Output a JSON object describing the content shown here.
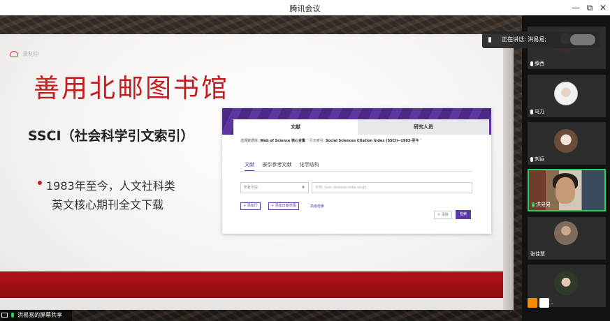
{
  "window": {
    "title": "腾讯会议",
    "minimize": "—",
    "restore": "⧉",
    "close": "✕"
  },
  "slide": {
    "recording_label": "录制中",
    "title": "善用北邮图书馆",
    "subtitle": "SSCI（社会科学引文索引）",
    "bullet_line1": "1983年至今，人文社科类",
    "bullet_line2": "英文核心期刊全文下载"
  },
  "wos": {
    "tab_documents": "文献",
    "tab_researchers": "研究人员",
    "db_label": "选择数据库:",
    "db_value": "Web of Science 核心合集",
    "index_label": "引文索引:",
    "index_value": "Social Sciences Citation Index (SSCI)--1983-至今",
    "subtab_docs": "文献",
    "subtab_cited": "被引参考文献",
    "subtab_chem": "化学结构",
    "field_select": "所有字段",
    "search_placeholder": "示例: liver disease india singh",
    "add_row": "+ 添加行",
    "add_date": "+ 添加日期范围",
    "advanced": "高级检索",
    "clear": "× 清除",
    "search": "检索"
  },
  "share": {
    "label": "洪易易的屏幕共享"
  },
  "speaker": {
    "label": "正在讲话: 洪易易;"
  },
  "participants": [
    {
      "name": "薛西"
    },
    {
      "name": "马力"
    },
    {
      "name": "刘运"
    },
    {
      "name": "洪易易"
    },
    {
      "name": "张佳慧"
    },
    {
      "name": "."
    }
  ]
}
